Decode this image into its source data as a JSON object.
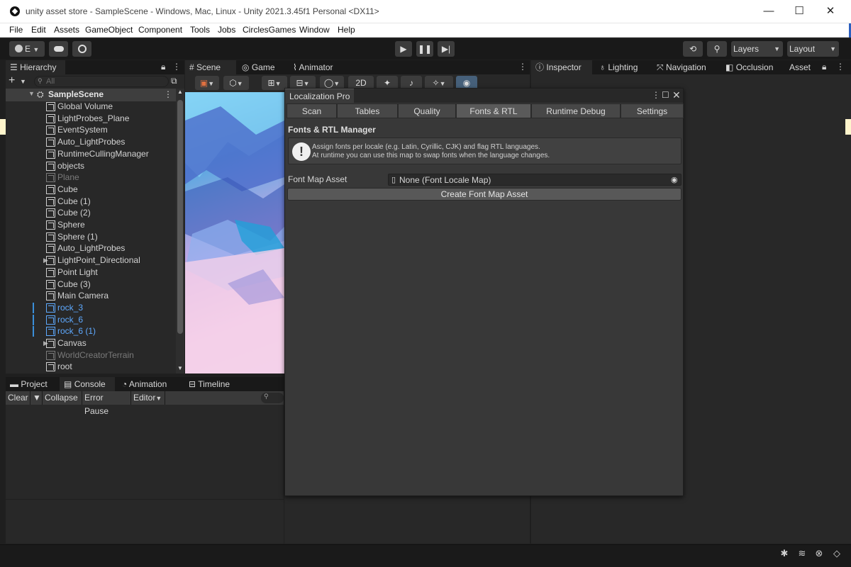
{
  "window": {
    "title": "unity asset store - SampleScene - Windows, Mac, Linux - Unity 2021.3.45f1 Personal <DX11>",
    "controls": [
      "—",
      "☐",
      "✕"
    ]
  },
  "menu": [
    "File",
    "Edit",
    "Assets",
    "GameObject",
    "Component",
    "Tools",
    "Jobs",
    "CirclesGames",
    "Window",
    "Help"
  ],
  "toolbar": {
    "account_label": "E",
    "layers_label": "Layers",
    "layout_label": "Layout"
  },
  "hierarchy": {
    "tab_label": "Hierarchy",
    "search_placeholder": "All",
    "scene_name": "SampleScene",
    "items": [
      {
        "label": "Global Volume",
        "style": "normal",
        "expander": false
      },
      {
        "label": "LightProbes_Plane",
        "style": "normal",
        "expander": false
      },
      {
        "label": "EventSystem",
        "style": "normal",
        "expander": false
      },
      {
        "label": "Auto_LightProbes",
        "style": "normal",
        "expander": false
      },
      {
        "label": "RuntimeCullingManager",
        "style": "normal",
        "expander": false
      },
      {
        "label": "objects",
        "style": "normal",
        "expander": false
      },
      {
        "label": "Plane",
        "style": "dim",
        "expander": false
      },
      {
        "label": "Cube",
        "style": "normal",
        "expander": false
      },
      {
        "label": "Cube (1)",
        "style": "normal",
        "expander": false
      },
      {
        "label": "Cube (2)",
        "style": "normal",
        "expander": false
      },
      {
        "label": "Sphere",
        "style": "normal",
        "expander": false
      },
      {
        "label": "Sphere (1)",
        "style": "normal",
        "expander": false
      },
      {
        "label": "Auto_LightProbes",
        "style": "normal",
        "expander": false
      },
      {
        "label": "LightPoint_Directional",
        "style": "normal",
        "expander": true
      },
      {
        "label": "Point Light",
        "style": "normal",
        "expander": false
      },
      {
        "label": "Cube (3)",
        "style": "normal",
        "expander": false
      },
      {
        "label": "Main Camera",
        "style": "normal",
        "expander": false
      },
      {
        "label": "rock_3",
        "style": "blue",
        "expander": false
      },
      {
        "label": "rock_6",
        "style": "blue",
        "expander": false
      },
      {
        "label": "rock_6 (1)",
        "style": "blue",
        "expander": false
      },
      {
        "label": "Canvas",
        "style": "normal",
        "expander": true
      },
      {
        "label": "WorldCreatorTerrain",
        "style": "dim",
        "expander": false
      },
      {
        "label": "root",
        "style": "normal",
        "expander": false
      }
    ]
  },
  "center_tabs": [
    "Scene",
    "Game",
    "Animator"
  ],
  "scene_toolbar": {
    "mode_2d": "2D"
  },
  "right_tabs": [
    "Inspector",
    "Lighting",
    "Navigation",
    "Occlusion",
    "Asset"
  ],
  "bottom_tabs": [
    "Project",
    "Console",
    "Animation",
    "Timeline"
  ],
  "console": {
    "clear_label": "Clear",
    "collapse_label": "Collapse",
    "error_pause_label": "Error Pause",
    "editor_label": "Editor"
  },
  "localization": {
    "window_title": "Localization Pro",
    "tabs": [
      "Scan",
      "Tables",
      "Quality",
      "Fonts & RTL",
      "Runtime Debug",
      "Settings"
    ],
    "active_tab": "Fonts & RTL",
    "section_title": "Fonts & RTL Manager",
    "help_line1": "Assign fonts per locale (e.g. Latin, Cyrillic, CJK) and flag RTL languages.",
    "help_line2": "At runtime you can use this map to swap fonts when the language changes.",
    "field_label": "Font Map Asset",
    "field_value": "None (Font Locale Map)",
    "create_button": "Create Font Map Asset"
  }
}
